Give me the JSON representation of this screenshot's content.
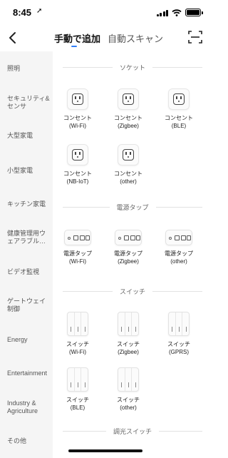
{
  "status": {
    "time": "8:45",
    "location_icon": "location-arrow-icon",
    "battery_level": 1.0
  },
  "header": {
    "back_icon": "chevron-left-icon",
    "tabs": [
      {
        "label": "手動で追加",
        "active": true
      },
      {
        "label": "自動スキャン",
        "active": false
      }
    ],
    "scan_icon": "scan-icon",
    "accent": "#2f7df6"
  },
  "sidebar": {
    "items": [
      {
        "label": "照明"
      },
      {
        "label": "セキュリティ&センサ"
      },
      {
        "label": "大型家電"
      },
      {
        "label": "小型家電"
      },
      {
        "label": "キッチン家電"
      },
      {
        "label": "健康管理用ウェアラブル…"
      },
      {
        "label": "ビデオ監視"
      },
      {
        "label": "ゲートウェイ制御"
      },
      {
        "label": "Energy"
      },
      {
        "label": "Entertainment"
      },
      {
        "label": "Industry & Agriculture"
      },
      {
        "label": "その他"
      }
    ]
  },
  "sections": {
    "socket": {
      "title": "ソケット",
      "devices": [
        {
          "name": "コンセント",
          "variant": "(Wi-Fi)"
        },
        {
          "name": "コンセント",
          "variant": "(Zigbee)"
        },
        {
          "name": "コンセント",
          "variant": "(BLE)"
        },
        {
          "name": "コンセント",
          "variant": "(NB-IoT)"
        },
        {
          "name": "コンセント",
          "variant": "(other)"
        }
      ]
    },
    "strip": {
      "title": "電源タップ",
      "devices": [
        {
          "name": "電源タップ",
          "variant": "(Wi-Fi)"
        },
        {
          "name": "電源タップ",
          "variant": "(Zigbee)"
        },
        {
          "name": "電源タップ",
          "variant": "(other)"
        }
      ]
    },
    "switch": {
      "title": "スイッチ",
      "devices": [
        {
          "name": "スイッチ",
          "variant": "(Wi-Fi)"
        },
        {
          "name": "スイッチ",
          "variant": "(Zigbee)"
        },
        {
          "name": "スイッチ",
          "variant": "(GPRS)"
        },
        {
          "name": "スイッチ",
          "variant": "(BLE)"
        },
        {
          "name": "スイッチ",
          "variant": "(other)"
        }
      ]
    },
    "dimmer": {
      "title": "調光スイッチ"
    }
  }
}
